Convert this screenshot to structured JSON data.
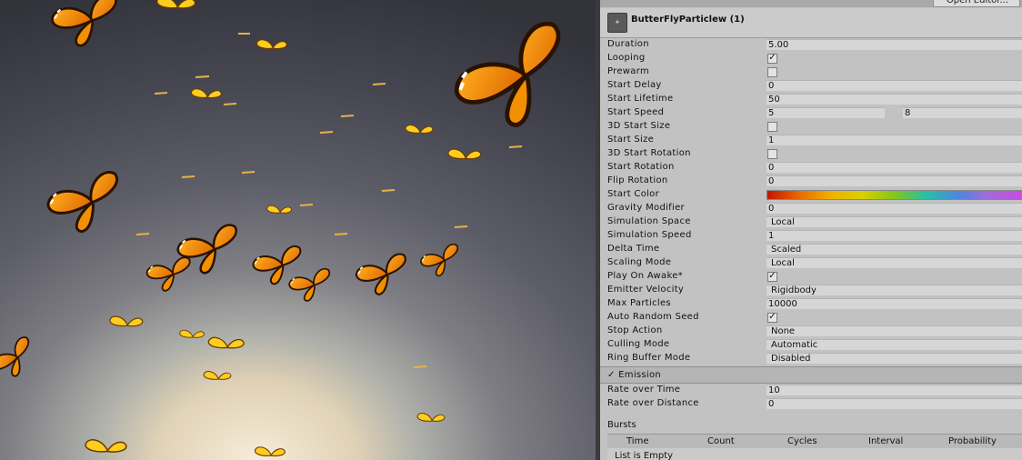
{
  "toolbar": {
    "open_editor_label": "Open Editor..."
  },
  "component": {
    "title": "ButterFlyParticlew (1)",
    "icon": "particle-system-icon"
  },
  "properties": [
    {
      "label": "Duration",
      "type": "text",
      "value": "5.00"
    },
    {
      "label": "Looping",
      "type": "check",
      "value": "✓"
    },
    {
      "label": "Prewarm",
      "type": "check",
      "value": ""
    },
    {
      "label": "Start Delay",
      "type": "text",
      "value": "0"
    },
    {
      "label": "Start Lifetime",
      "type": "text",
      "value": "50"
    },
    {
      "label": "Start Speed",
      "type": "pair",
      "value": "5",
      "value2": "8"
    },
    {
      "label": "3D Start Size",
      "type": "check",
      "value": ""
    },
    {
      "label": "Start Size",
      "type": "text",
      "value": "1"
    },
    {
      "label": "3D Start Rotation",
      "type": "check",
      "value": ""
    },
    {
      "label": "Start Rotation",
      "type": "text",
      "value": "0"
    },
    {
      "label": "Flip Rotation",
      "type": "text",
      "value": "0"
    },
    {
      "label": "Start Color",
      "type": "gradient",
      "value": ""
    },
    {
      "label": "Gravity Modifier",
      "type": "text",
      "value": "0"
    },
    {
      "label": "Simulation Space",
      "type": "dropdown",
      "value": "Local"
    },
    {
      "label": "Simulation Speed",
      "type": "text",
      "value": "1"
    },
    {
      "label": "Delta Time",
      "type": "dropdown",
      "value": "Scaled"
    },
    {
      "label": "Scaling Mode",
      "type": "dropdown",
      "value": "Local"
    },
    {
      "label": "Play On Awake*",
      "type": "check",
      "value": "✓"
    },
    {
      "label": "Emitter Velocity",
      "type": "dropdown",
      "value": "Rigidbody"
    },
    {
      "label": "Max Particles",
      "type": "text",
      "value": "10000"
    },
    {
      "label": "Auto Random Seed",
      "type": "check",
      "value": "✓"
    },
    {
      "label": "Stop Action",
      "type": "dropdown",
      "value": "None"
    },
    {
      "label": "Culling Mode",
      "type": "dropdown",
      "value": "Automatic"
    },
    {
      "label": "Ring Buffer Mode",
      "type": "dropdown",
      "value": "Disabled"
    }
  ],
  "emission": {
    "section_label": "Emission",
    "enabled_mark": "✓",
    "rows": [
      {
        "label": "Rate over Time",
        "value": "10"
      },
      {
        "label": "Rate over Distance",
        "value": "0"
      }
    ],
    "bursts_label": "Bursts",
    "burst_columns": [
      "Time",
      "Count",
      "Cycles",
      "Interval",
      "Probability"
    ],
    "empty_text": "List is Empty"
  }
}
